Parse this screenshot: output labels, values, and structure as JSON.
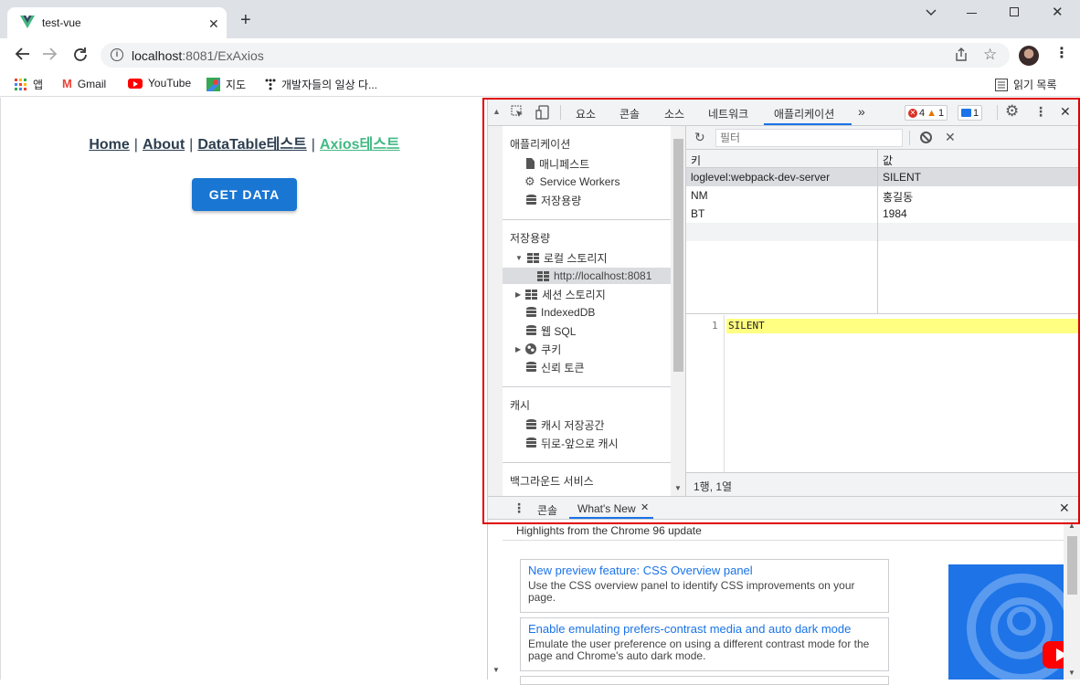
{
  "browser": {
    "tab_title": "test-vue",
    "url_host": "localhost",
    "url_rest": ":8081/ExAxios",
    "bookmarks": [
      "앱",
      "Gmail",
      "YouTube",
      "지도",
      "개발자들의 일상 다..."
    ],
    "reading_list": "읽기 목록"
  },
  "page": {
    "nav": [
      "Home",
      "About",
      "DataTable테스트",
      "Axios테스트"
    ],
    "nav_separator": "|",
    "button": "GET DATA"
  },
  "devtools": {
    "tabs": [
      "요소",
      "콘솔",
      "소스",
      "네트워크",
      "애플리케이션"
    ],
    "more": "»",
    "errors": "4",
    "warnings": "1",
    "messages": "1",
    "sidebar": {
      "app_section": "애플리케이션",
      "app_items": [
        "매니페스트",
        "Service Workers",
        "저장용량"
      ],
      "storage_section": "저장용량",
      "local_storage": "로컬 스토리지",
      "local_origin": "http://localhost:8081",
      "session_storage": "세션 스토리지",
      "indexeddb": "IndexedDB",
      "websql": "웹 SQL",
      "cookies": "쿠키",
      "trust_tokens": "신뢰 토큰",
      "cache_section": "캐시",
      "cache_items": [
        "캐시 저장공간",
        "뒤로-앞으로 캐시"
      ],
      "bg_section": "백그라운드 서비스"
    },
    "filter_placeholder": "필터",
    "table": {
      "headers": [
        "키",
        "값"
      ],
      "rows": [
        {
          "key": "loglevel:webpack-dev-server",
          "value": "SILENT"
        },
        {
          "key": "NM",
          "value": "홍길동"
        },
        {
          "key": "BT",
          "value": "1984"
        }
      ]
    },
    "editor": {
      "line": "1",
      "text": "SILENT"
    },
    "status": "1행, 1열",
    "drawer": {
      "tabs": [
        "콘솔",
        "What's New"
      ],
      "header": "Highlights from the Chrome 96 update",
      "cards": [
        {
          "title": "New preview feature: CSS Overview panel",
          "desc": "Use the CSS overview panel to identify CSS improvements on your page."
        },
        {
          "title": "Enable emulating prefers-contrast media and auto dark mode",
          "desc": "Emulate the user preference on using a different contrast mode for the page and Chrome's auto dark mode."
        }
      ]
    }
  }
}
